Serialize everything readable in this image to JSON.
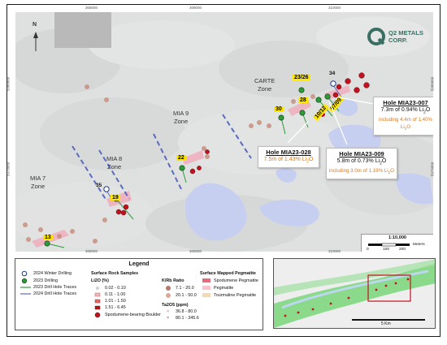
{
  "map": {
    "logo_text_line1": "Q2 METALS",
    "logo_text_line2": "CORP.",
    "north_label": "N",
    "zones": [
      {
        "id": "carte",
        "line1": "CARTE",
        "line2": "Zone"
      },
      {
        "id": "mia9",
        "line1": "MIA 9",
        "line2": "Zone"
      },
      {
        "id": "mia8",
        "line1": "MIA 8",
        "line2": "Zone"
      },
      {
        "id": "mia7",
        "line1": "MIA 7",
        "line2": "Zone"
      }
    ],
    "hole_labels": {
      "h34": "34",
      "h23_26": "23/26",
      "h28": "28",
      "h10_12": "10/12",
      "h07_09": "07/09",
      "h30": "30",
      "h22": "22",
      "h35": "35",
      "h19": "19",
      "h13": "13"
    },
    "callouts": {
      "mia23_007": {
        "title": "Hole MIA23-007",
        "main": "7.3m of 0.94% Li",
        "main_sub": "2",
        "main_end": "O",
        "inc": "including 4.4m of 1.40% Li",
        "inc_sub": "2",
        "inc_end": "O"
      },
      "mia23_028": {
        "title": "Hole MIA23-028",
        "main": "7.5m of 1.43% Li",
        "main_sub": "2",
        "main_end": "O"
      },
      "mia23_009": {
        "title": "Hole MIA23-009",
        "main": "5.8m of 0.73% Li",
        "main_sub": "2",
        "main_end": "O",
        "inc": "including 3.0m of 1.19% Li",
        "inc_sub": "2",
        "inc_end": "O"
      }
    },
    "coords_top": [
      "308000",
      "309000",
      "310000"
    ],
    "coords_bottom": [
      "308000",
      "309000",
      "310000"
    ],
    "coords_left": [
      "5980000",
      "5979000"
    ],
    "coords_right": [
      "5980000",
      "5979000"
    ],
    "scale_ratio": "1:10,000",
    "scale_ticks": [
      "0",
      "100",
      "200"
    ],
    "scale_unit": "Meters"
  },
  "legend": {
    "title": "Legend",
    "drilling": [
      {
        "label": "2024 Winter Drilling"
      },
      {
        "label": "2023 Drilling"
      },
      {
        "label": "2023 Drill Hole Traces"
      },
      {
        "label": "2024 Drill Hole Traces"
      }
    ],
    "rock_title": "Surface Rock Samples",
    "li2o_title": "Li2O (%)",
    "li2o_classes": [
      "0.02 - 0.10",
      "0.11 - 1.00",
      "1.01 - 1.50",
      "1.51 - 6.45"
    ],
    "boulder_label": "Spodumene-bearing Boulder",
    "krb_title": "K/Rb Ratio",
    "krb_classes": [
      "7.1 - 20.0",
      "20.1 - 50.0"
    ],
    "ta_title": "Ta2O5 (ppm)",
    "ta_classes": [
      "36.8 - 80.0",
      "80.1 - 345.6"
    ],
    "peg_title": "Surface Mapped Pegmatite",
    "peg_classes": [
      "Spodumene Pegmatite",
      "Pegmatite",
      "Tourmaline Pegmatite"
    ],
    "colors": {
      "winter2024": "#1f3a8a",
      "drill2023": "#2e9b3a",
      "trace2023": "#2e9b3a",
      "trace2024": "#5a6bc0"
    }
  },
  "inset": {
    "scale_label": "5 Km"
  }
}
